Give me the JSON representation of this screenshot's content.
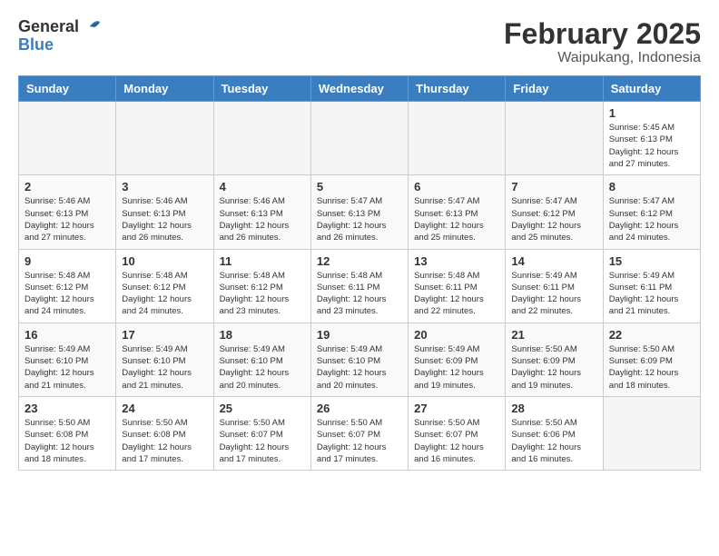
{
  "logo": {
    "general": "General",
    "blue": "Blue"
  },
  "title": "February 2025",
  "subtitle": "Waipukang, Indonesia",
  "days_of_week": [
    "Sunday",
    "Monday",
    "Tuesday",
    "Wednesday",
    "Thursday",
    "Friday",
    "Saturday"
  ],
  "weeks": [
    [
      {
        "day": "",
        "detail": ""
      },
      {
        "day": "",
        "detail": ""
      },
      {
        "day": "",
        "detail": ""
      },
      {
        "day": "",
        "detail": ""
      },
      {
        "day": "",
        "detail": ""
      },
      {
        "day": "",
        "detail": ""
      },
      {
        "day": "1",
        "detail": "Sunrise: 5:45 AM\nSunset: 6:13 PM\nDaylight: 12 hours\nand 27 minutes."
      }
    ],
    [
      {
        "day": "2",
        "detail": "Sunrise: 5:46 AM\nSunset: 6:13 PM\nDaylight: 12 hours\nand 27 minutes."
      },
      {
        "day": "3",
        "detail": "Sunrise: 5:46 AM\nSunset: 6:13 PM\nDaylight: 12 hours\nand 26 minutes."
      },
      {
        "day": "4",
        "detail": "Sunrise: 5:46 AM\nSunset: 6:13 PM\nDaylight: 12 hours\nand 26 minutes."
      },
      {
        "day": "5",
        "detail": "Sunrise: 5:47 AM\nSunset: 6:13 PM\nDaylight: 12 hours\nand 26 minutes."
      },
      {
        "day": "6",
        "detail": "Sunrise: 5:47 AM\nSunset: 6:13 PM\nDaylight: 12 hours\nand 25 minutes."
      },
      {
        "day": "7",
        "detail": "Sunrise: 5:47 AM\nSunset: 6:12 PM\nDaylight: 12 hours\nand 25 minutes."
      },
      {
        "day": "8",
        "detail": "Sunrise: 5:47 AM\nSunset: 6:12 PM\nDaylight: 12 hours\nand 24 minutes."
      }
    ],
    [
      {
        "day": "9",
        "detail": "Sunrise: 5:48 AM\nSunset: 6:12 PM\nDaylight: 12 hours\nand 24 minutes."
      },
      {
        "day": "10",
        "detail": "Sunrise: 5:48 AM\nSunset: 6:12 PM\nDaylight: 12 hours\nand 24 minutes."
      },
      {
        "day": "11",
        "detail": "Sunrise: 5:48 AM\nSunset: 6:12 PM\nDaylight: 12 hours\nand 23 minutes."
      },
      {
        "day": "12",
        "detail": "Sunrise: 5:48 AM\nSunset: 6:11 PM\nDaylight: 12 hours\nand 23 minutes."
      },
      {
        "day": "13",
        "detail": "Sunrise: 5:48 AM\nSunset: 6:11 PM\nDaylight: 12 hours\nand 22 minutes."
      },
      {
        "day": "14",
        "detail": "Sunrise: 5:49 AM\nSunset: 6:11 PM\nDaylight: 12 hours\nand 22 minutes."
      },
      {
        "day": "15",
        "detail": "Sunrise: 5:49 AM\nSunset: 6:11 PM\nDaylight: 12 hours\nand 21 minutes."
      }
    ],
    [
      {
        "day": "16",
        "detail": "Sunrise: 5:49 AM\nSunset: 6:10 PM\nDaylight: 12 hours\nand 21 minutes."
      },
      {
        "day": "17",
        "detail": "Sunrise: 5:49 AM\nSunset: 6:10 PM\nDaylight: 12 hours\nand 21 minutes."
      },
      {
        "day": "18",
        "detail": "Sunrise: 5:49 AM\nSunset: 6:10 PM\nDaylight: 12 hours\nand 20 minutes."
      },
      {
        "day": "19",
        "detail": "Sunrise: 5:49 AM\nSunset: 6:10 PM\nDaylight: 12 hours\nand 20 minutes."
      },
      {
        "day": "20",
        "detail": "Sunrise: 5:49 AM\nSunset: 6:09 PM\nDaylight: 12 hours\nand 19 minutes."
      },
      {
        "day": "21",
        "detail": "Sunrise: 5:50 AM\nSunset: 6:09 PM\nDaylight: 12 hours\nand 19 minutes."
      },
      {
        "day": "22",
        "detail": "Sunrise: 5:50 AM\nSunset: 6:09 PM\nDaylight: 12 hours\nand 18 minutes."
      }
    ],
    [
      {
        "day": "23",
        "detail": "Sunrise: 5:50 AM\nSunset: 6:08 PM\nDaylight: 12 hours\nand 18 minutes."
      },
      {
        "day": "24",
        "detail": "Sunrise: 5:50 AM\nSunset: 6:08 PM\nDaylight: 12 hours\nand 17 minutes."
      },
      {
        "day": "25",
        "detail": "Sunrise: 5:50 AM\nSunset: 6:07 PM\nDaylight: 12 hours\nand 17 minutes."
      },
      {
        "day": "26",
        "detail": "Sunrise: 5:50 AM\nSunset: 6:07 PM\nDaylight: 12 hours\nand 17 minutes."
      },
      {
        "day": "27",
        "detail": "Sunrise: 5:50 AM\nSunset: 6:07 PM\nDaylight: 12 hours\nand 16 minutes."
      },
      {
        "day": "28",
        "detail": "Sunrise: 5:50 AM\nSunset: 6:06 PM\nDaylight: 12 hours\nand 16 minutes."
      },
      {
        "day": "",
        "detail": ""
      }
    ]
  ]
}
